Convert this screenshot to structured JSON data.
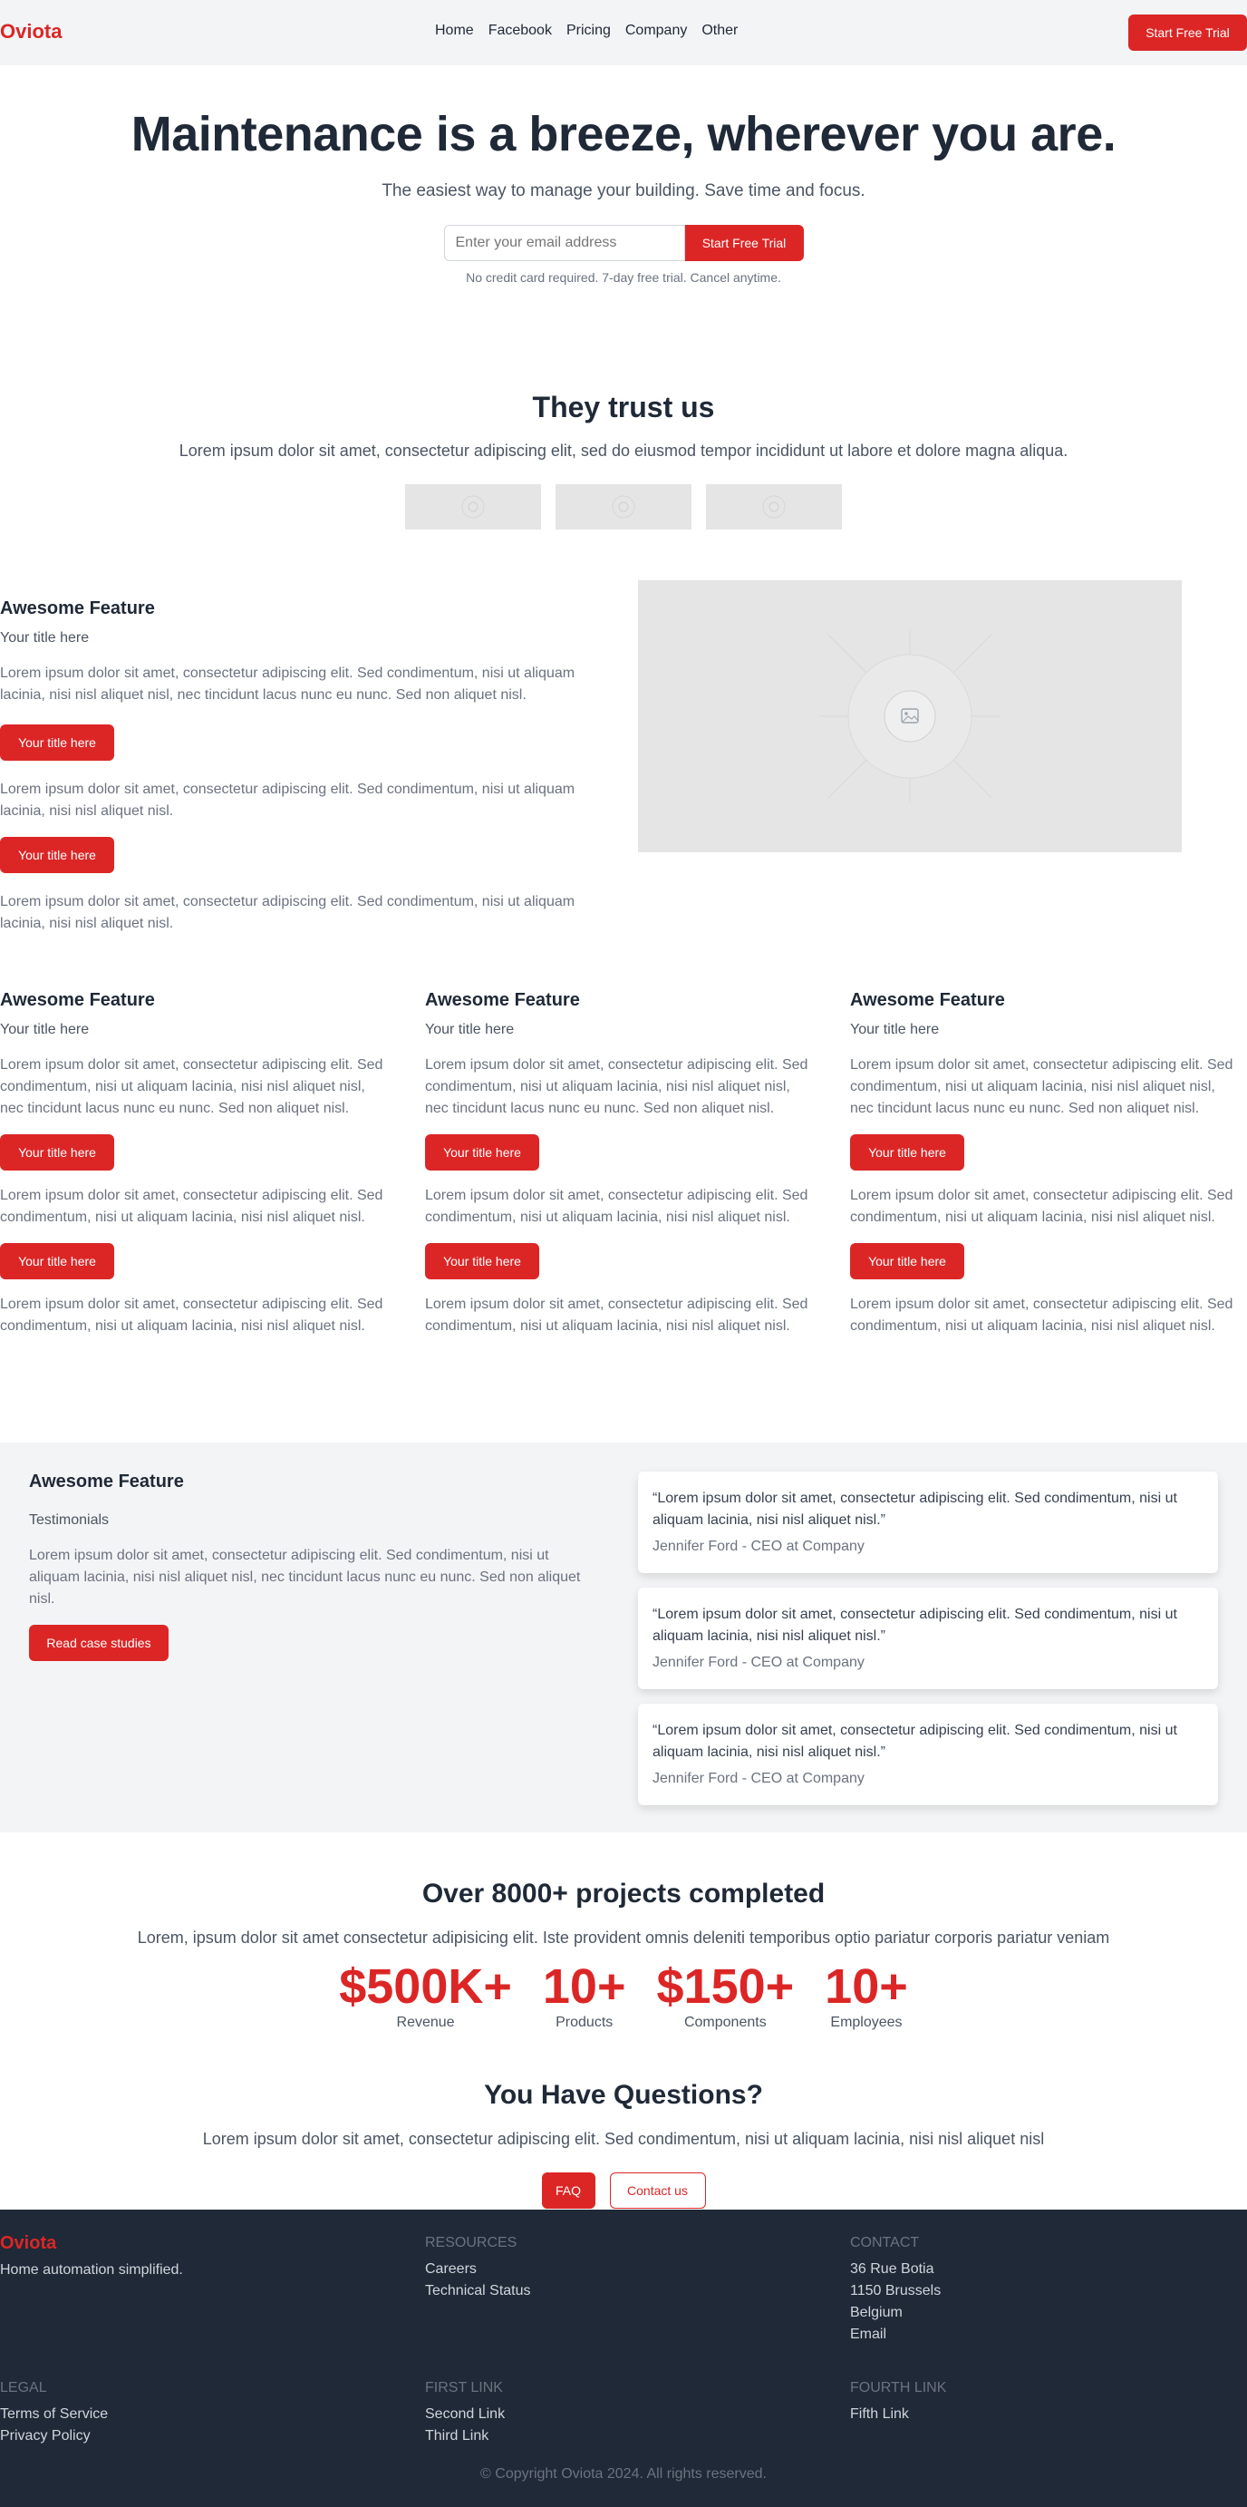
{
  "header": {
    "logo": "Oviota",
    "nav": [
      "Home",
      "Facebook",
      "Pricing",
      "Company",
      "Other"
    ],
    "cta": "Start Free Trial"
  },
  "hero": {
    "title": "Maintenance is a breeze, wherever you are.",
    "subtitle": "The easiest way to manage your building. Save time and focus.",
    "email_placeholder": "Enter your email address",
    "cta": "Start Free Trial",
    "note": "No credit card required. 7-day free trial. Cancel anytime."
  },
  "trust": {
    "title": "They trust us",
    "text": "Lorem ipsum dolor sit amet, consectetur adipiscing elit, sed do eiusmod tempor incididunt ut labore et dolore magna aliqua."
  },
  "feature_main": {
    "title": "Awesome Feature",
    "subtitle": "Your title here",
    "p1": "Lorem ipsum dolor sit amet, consectetur adipiscing elit. Sed condimentum, nisi ut aliquam lacinia, nisi nisl aliquet nisl, nec tincidunt lacus nunc eu nunc. Sed non aliquet nisl.",
    "btn1": "Your title here",
    "p2": "Lorem ipsum dolor sit amet, consectetur adipiscing elit. Sed condimentum, nisi ut aliquam lacinia, nisi nisl aliquet nisl.",
    "btn2": "Your title here",
    "p3": "Lorem ipsum dolor sit amet, consectetur adipiscing elit. Sed condimentum, nisi ut aliquam lacinia, nisi nisl aliquet nisl."
  },
  "feature_cols": [
    {
      "title": "Awesome Feature",
      "subtitle": "Your title here",
      "p1": "Lorem ipsum dolor sit amet, consectetur adipiscing elit. Sed condimentum, nisi ut aliquam lacinia, nisi nisl aliquet nisl, nec tincidunt lacus nunc eu nunc. Sed non aliquet nisl.",
      "btn1": "Your title here",
      "p2": "Lorem ipsum dolor sit amet, consectetur adipiscing elit. Sed condimentum, nisi ut aliquam lacinia, nisi nisl aliquet nisl.",
      "btn2": "Your title here",
      "p3": "Lorem ipsum dolor sit amet, consectetur adipiscing elit. Sed condimentum, nisi ut aliquam lacinia, nisi nisl aliquet nisl."
    },
    {
      "title": "Awesome Feature",
      "subtitle": "Your title here",
      "p1": "Lorem ipsum dolor sit amet, consectetur adipiscing elit. Sed condimentum, nisi ut aliquam lacinia, nisi nisl aliquet nisl, nec tincidunt lacus nunc eu nunc. Sed non aliquet nisl.",
      "btn1": "Your title here",
      "p2": "Lorem ipsum dolor sit amet, consectetur adipiscing elit. Sed condimentum, nisi ut aliquam lacinia, nisi nisl aliquet nisl.",
      "btn2": "Your title here",
      "p3": "Lorem ipsum dolor sit amet, consectetur adipiscing elit. Sed condimentum, nisi ut aliquam lacinia, nisi nisl aliquet nisl."
    },
    {
      "title": "Awesome Feature",
      "subtitle": "Your title here",
      "p1": "Lorem ipsum dolor sit amet, consectetur adipiscing elit. Sed condimentum, nisi ut aliquam lacinia, nisi nisl aliquet nisl, nec tincidunt lacus nunc eu nunc. Sed non aliquet nisl.",
      "btn1": "Your title here",
      "p2": "Lorem ipsum dolor sit amet, consectetur adipiscing elit. Sed condimentum, nisi ut aliquam lacinia, nisi nisl aliquet nisl.",
      "btn2": "Your title here",
      "p3": "Lorem ipsum dolor sit amet, consectetur adipiscing elit. Sed condimentum, nisi ut aliquam lacinia, nisi nisl aliquet nisl."
    }
  ],
  "testimonials": {
    "title": "Awesome Feature",
    "subtitle": "Testimonials",
    "text": "Lorem ipsum dolor sit amet, consectetur adipiscing elit. Sed condimentum, nisi ut aliquam lacinia, nisi nisl aliquet nisl, nec tincidunt lacus nunc eu nunc. Sed non aliquet nisl.",
    "cta": "Read case studies",
    "cards": [
      {
        "quote": "“Lorem ipsum dolor sit amet, consectetur adipiscing elit. Sed condimentum, nisi ut aliquam lacinia, nisi nisl aliquet nisl.”",
        "author": "Jennifer Ford - CEO at Company"
      },
      {
        "quote": "“Lorem ipsum dolor sit amet, consectetur adipiscing elit. Sed condimentum, nisi ut aliquam lacinia, nisi nisl aliquet nisl.”",
        "author": "Jennifer Ford - CEO at Company"
      },
      {
        "quote": "“Lorem ipsum dolor sit amet, consectetur adipiscing elit. Sed condimentum, nisi ut aliquam lacinia, nisi nisl aliquet nisl.”",
        "author": "Jennifer Ford - CEO at Company"
      }
    ]
  },
  "stats": {
    "title": "Over 8000+ projects completed",
    "text": "Lorem, ipsum dolor sit amet consectetur adipisicing elit. Iste provident omnis deleniti temporibus optio pariatur corporis pariatur veniam",
    "items": [
      {
        "value": "$500K+",
        "label": "Revenue"
      },
      {
        "value": "10+",
        "label": "Products"
      },
      {
        "value": "$150+",
        "label": "Components"
      },
      {
        "value": "10+",
        "label": "Employees"
      }
    ]
  },
  "questions": {
    "title": "You Have Questions?",
    "text": "Lorem ipsum dolor sit amet, consectetur adipiscing elit. Sed condimentum, nisi ut aliquam lacinia, nisi nisl aliquet nisl",
    "faq": "FAQ",
    "contact": "Contact us"
  },
  "footer": {
    "logo": "Oviota",
    "tagline": "Home automation simplified.",
    "resources": {
      "heading": "RESOURCES",
      "links": [
        "Careers",
        "Technical Status"
      ]
    },
    "contact": {
      "heading": "CONTACT",
      "lines": [
        "36 Rue Botia",
        "1150 Brussels",
        "Belgium",
        "Email"
      ]
    },
    "legal": {
      "heading": "LEGAL",
      "links": [
        "Terms of Service",
        "Privacy Policy"
      ]
    },
    "first_link": {
      "heading": "FIRST LINK",
      "links": [
        "Second Link",
        "Third Link"
      ]
    },
    "fourth_link": {
      "heading": "FOURTH LINK",
      "links": [
        "Fifth Link"
      ]
    },
    "copyright": "© Copyright Oviota 2024. All rights reserved."
  },
  "colors": {
    "accent": "#dc2626",
    "dark": "#1f2937",
    "light_bg": "#f3f4f6",
    "placeholder_bg": "#e5e5e5"
  }
}
